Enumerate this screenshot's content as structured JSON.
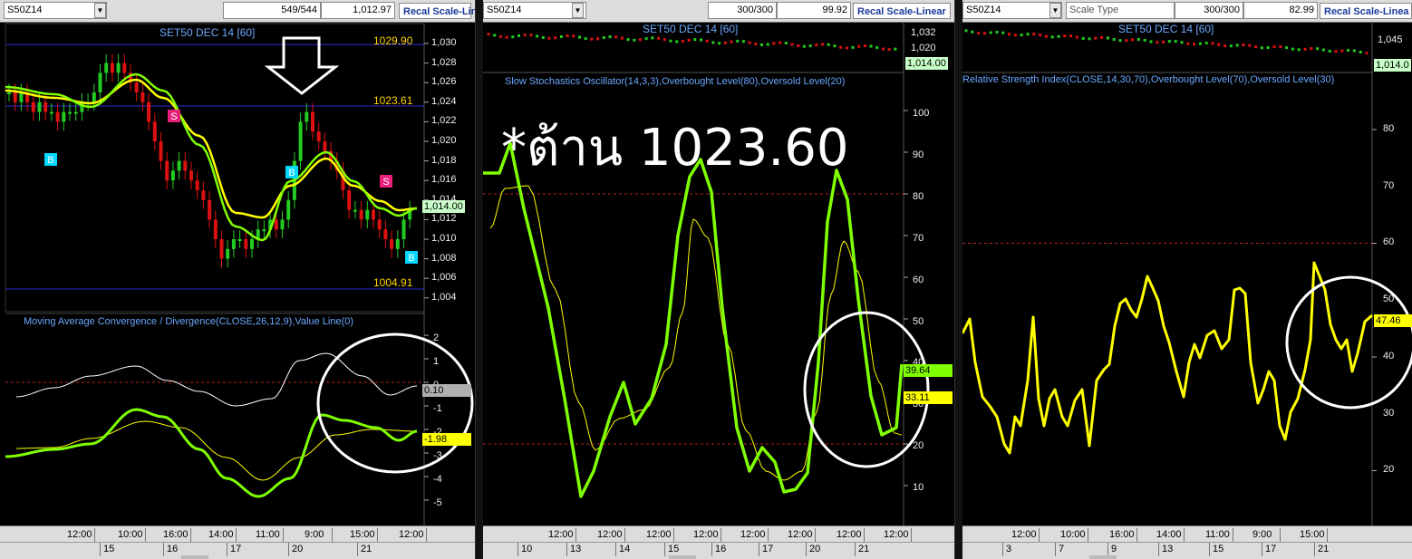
{
  "colors": {
    "up": "#22cc22",
    "down": "#dd1111",
    "signal": "#ffff00",
    "ema": "#7fff00",
    "grid": "#2d2dd0",
    "level": "#c02020",
    "circle": "#ffffff"
  },
  "panel1": {
    "symbol": "S50Z14",
    "count": "549/544",
    "price": "1,012.97",
    "scale_label": "Recal Scale-Linear",
    "title": "SET50 DEC 14   [60]",
    "hline_high": "1029.90",
    "hline_mid": "1023.61",
    "hline_low": "1004.91",
    "last_tag": "1,014.00",
    "price_axis": [
      "1,030",
      "1,028",
      "1,026",
      "1,024",
      "1,022",
      "1,020",
      "1,018",
      "1,016",
      "1,014",
      "1,012",
      "1,010",
      "1,008",
      "1,006",
      "1,004"
    ],
    "markers": [
      {
        "label": "B",
        "type": "buy"
      },
      {
        "label": "S",
        "type": "sell"
      },
      {
        "label": "B",
        "type": "buy"
      },
      {
        "label": "S",
        "type": "sell"
      },
      {
        "label": "B",
        "type": "buy"
      }
    ],
    "macd_title": "Moving Average Convergence / Divergence(CLOSE,26,12,9),Value Line(0)",
    "macd_axis": [
      "2",
      "1",
      "0",
      "-1",
      "-2",
      "-3",
      "-4",
      "-5"
    ],
    "macd_tag_hist": "0.10",
    "macd_tag_macd": "-1.98",
    "time_labels": [
      "12:00",
      "10:00",
      "16:00",
      "14:00",
      "11:00",
      "9:00",
      "15:00",
      "12:00"
    ],
    "date_labels": [
      "15",
      "16",
      "17",
      "20",
      "21"
    ]
  },
  "panel2": {
    "symbol": "S50Z14",
    "count": "300/300",
    "price": "99.92",
    "scale_label": "Recal Scale-Linear",
    "title": "SET50 DEC 14   [60]",
    "mini_axis": [
      "1,032",
      "1,020"
    ],
    "last_tag": "1,014.00",
    "ind_title": "Slow Stochastics Oscillator(14,3,3),Overbought Level(80),Oversold Level(20)",
    "annotation": "*ต้าน 1023.60",
    "axis": [
      "100",
      "90",
      "80",
      "70",
      "60",
      "50",
      "40",
      "30",
      "20",
      "10"
    ],
    "tag_k": "39.64",
    "tag_d": "33.11",
    "time_labels": [
      "12:00",
      "12:00",
      "12:00",
      "12:00",
      "12:00",
      "12:00",
      "12:00",
      "12:00"
    ],
    "date_labels": [
      "10",
      "13",
      "14",
      "15",
      "16",
      "17",
      "20",
      "21"
    ]
  },
  "panel3": {
    "symbol": "S50Z14",
    "scale_type": "Scale Type",
    "count": "300/300",
    "price": "82.99",
    "scale_label": "Recal Scale-Linea",
    "title": "SET50 DEC 14   [60]",
    "mini_axis": [
      "1,045"
    ],
    "last_tag": "1,014.0",
    "ind_title": "Relative Strength Index(CLOSE,14,30,70),Overbought Level(70),Oversold Level(30)",
    "axis": [
      "80",
      "70",
      "60",
      "50",
      "40",
      "30",
      "20"
    ],
    "tag_rsi": "47.46",
    "time_labels": [
      "12:00",
      "10:00",
      "16:00",
      "14:00",
      "11:00",
      "9:00",
      "15:00"
    ],
    "date_labels": [
      "3",
      "7",
      "9",
      "13",
      "15",
      "17",
      "21"
    ]
  }
}
